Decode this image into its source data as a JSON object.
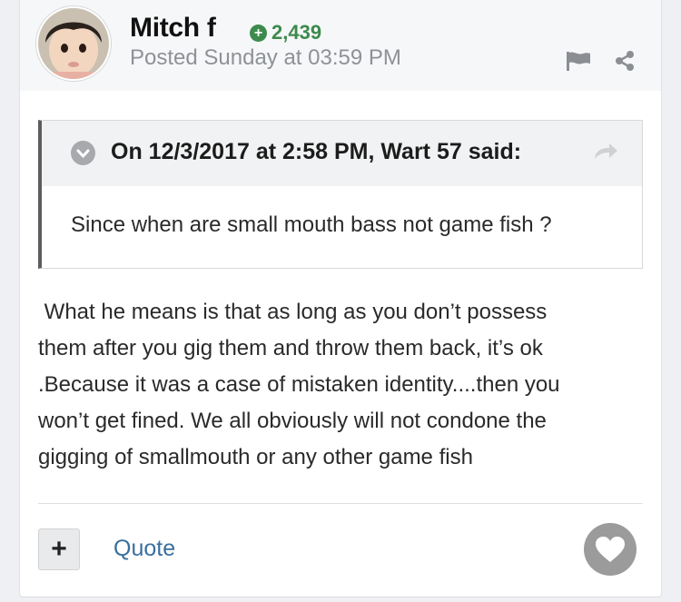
{
  "post": {
    "author": "Mitch f",
    "reputation": "2,439",
    "posted": "Posted Sunday at 03:59 PM",
    "quote": {
      "citation": "On 12/3/2017 at 2:58 PM, Wart 57 said:",
      "text": "Since when are small mouth bass not game fish ?"
    },
    "body_lines": [
      " What he means is that as long as you don’t possess",
      "them after you gig them and throw them back, it’s ok",
      ".Because it was a case of mistaken identity....then you",
      "won’t get fined. We all obviously will not condone the",
      "gigging of smallmouth or any other game fish"
    ]
  },
  "actions": {
    "plus_label": "+",
    "quote_label": "Quote"
  },
  "icons": {
    "reputation": "plus-circle-icon",
    "report": "flag-icon",
    "share": "share-icon",
    "collapse": "chevron-down-icon",
    "jump": "arrow-forward-icon",
    "like": "heart-icon"
  },
  "colors": {
    "reputation_green": "#3d8a4d",
    "link_blue": "#3a6f9e",
    "quote_border": "#5d5d5d"
  }
}
